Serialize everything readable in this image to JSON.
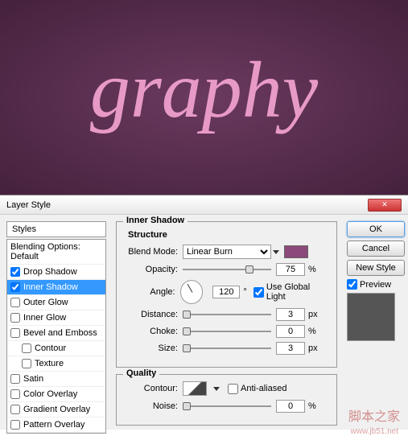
{
  "canvas": {
    "text": "graphy"
  },
  "dialog": {
    "title": "Layer Style"
  },
  "sidebar": {
    "header": "Styles",
    "blending": "Blending Options: Default",
    "items": [
      {
        "label": "Drop Shadow",
        "checked": true,
        "selected": false
      },
      {
        "label": "Inner Shadow",
        "checked": true,
        "selected": true
      },
      {
        "label": "Outer Glow",
        "checked": false,
        "selected": false
      },
      {
        "label": "Inner Glow",
        "checked": false,
        "selected": false
      },
      {
        "label": "Bevel and Emboss",
        "checked": false,
        "selected": false
      },
      {
        "label": "Contour",
        "checked": false,
        "selected": false,
        "indent": true
      },
      {
        "label": "Texture",
        "checked": false,
        "selected": false,
        "indent": true
      },
      {
        "label": "Satin",
        "checked": false,
        "selected": false
      },
      {
        "label": "Color Overlay",
        "checked": false,
        "selected": false
      },
      {
        "label": "Gradient Overlay",
        "checked": false,
        "selected": false
      },
      {
        "label": "Pattern Overlay",
        "checked": false,
        "selected": false
      }
    ]
  },
  "panel": {
    "title": "Inner Shadow",
    "structure": {
      "heading": "Structure",
      "blend_mode_label": "Blend Mode:",
      "blend_mode_value": "Linear Burn",
      "opacity_label": "Opacity:",
      "opacity_value": "75",
      "opacity_unit": "%",
      "angle_label": "Angle:",
      "angle_value": "120",
      "angle_unit": "°",
      "global_light": "Use Global Light",
      "distance_label": "Distance:",
      "distance_value": "3",
      "distance_unit": "px",
      "choke_label": "Choke:",
      "choke_value": "0",
      "choke_unit": "%",
      "size_label": "Size:",
      "size_value": "3",
      "size_unit": "px"
    },
    "quality": {
      "heading": "Quality",
      "contour_label": "Contour:",
      "antialiased": "Anti-aliased",
      "noise_label": "Noise:",
      "noise_value": "0",
      "noise_unit": "%"
    }
  },
  "buttons": {
    "ok": "OK",
    "cancel": "Cancel",
    "new_style": "New Style",
    "preview": "Preview"
  },
  "watermark": {
    "text": "脚本之家",
    "url": "www.jb51.net"
  }
}
